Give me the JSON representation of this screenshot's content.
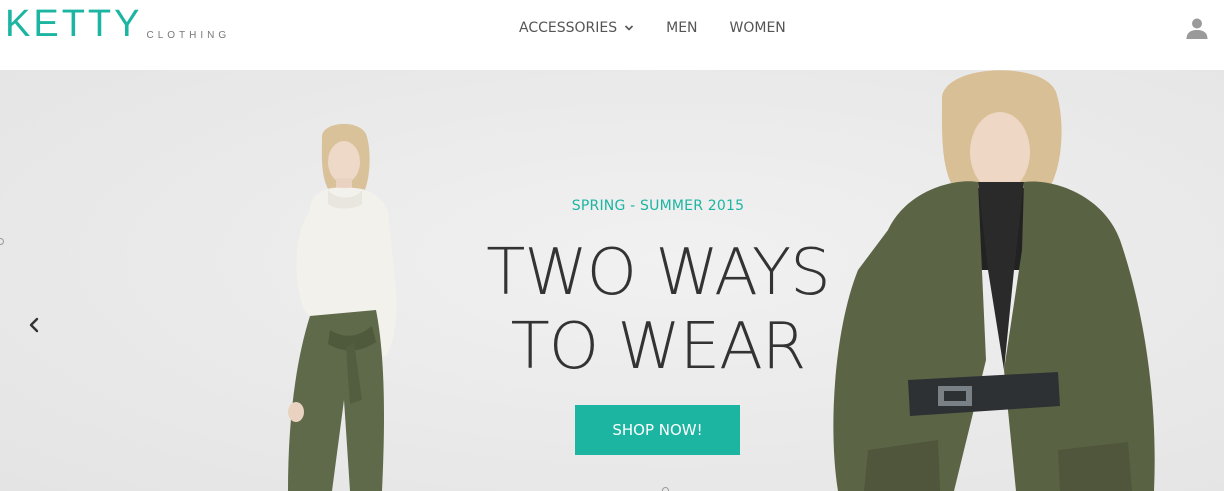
{
  "brand": {
    "name": "KETTY",
    "tagline": "CLOTHING",
    "accent_color": "#1cb5a2"
  },
  "nav": {
    "items": [
      {
        "label": "ACCESSORIES",
        "has_dropdown": true,
        "icon": "chevron-down-icon"
      },
      {
        "label": "MEN"
      },
      {
        "label": "WOMEN"
      }
    ],
    "user_icon": "user-icon"
  },
  "hero": {
    "eyebrow": "SPRING - SUMMER 2015",
    "headline_line1": "TWO WAYS",
    "headline_line2": "TO WEAR",
    "cta_label": "SHOP NOW!",
    "prev_icon": "chevron-left-icon",
    "background_color": "#ebebeb",
    "button_color": "#1cb5a2",
    "headline_color": "#333333"
  }
}
